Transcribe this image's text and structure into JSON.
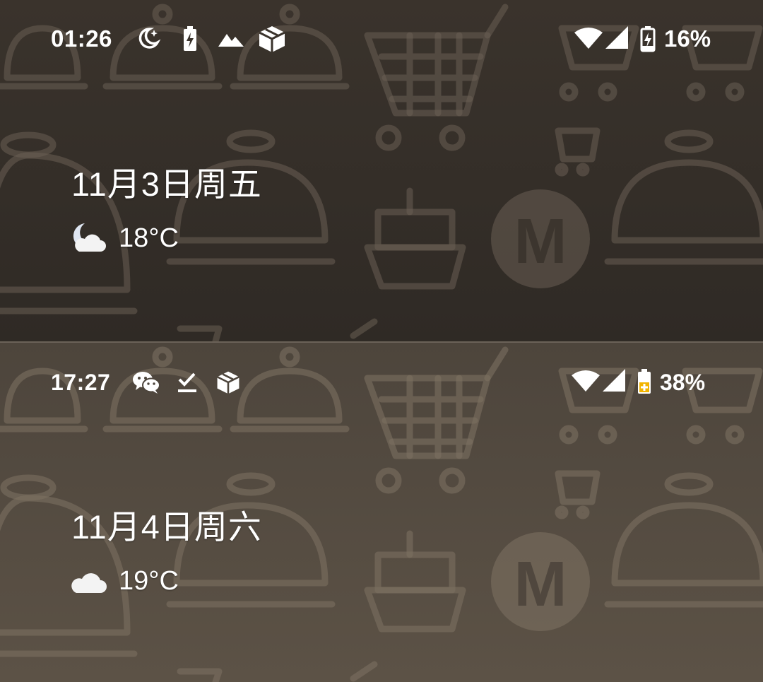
{
  "screens": [
    {
      "status_bar": {
        "time": "01:26",
        "notification_icons": [
          "do-not-disturb-moon-icon",
          "battery-saver-icon",
          "mountain-app-icon",
          "package-box-icon"
        ],
        "battery_percent": "16%",
        "battery_state": "charging"
      },
      "date": "11月3日周五",
      "weather": {
        "icon": "moon-cloud-icon",
        "temperature": "18°C"
      }
    },
    {
      "status_bar": {
        "time": "17:27",
        "notification_icons": [
          "wechat-icon",
          "download-done-icon",
          "package-box-icon"
        ],
        "battery_percent": "38%",
        "battery_state": "charging",
        "battery_accent": "#f2b400"
      },
      "date": "11月4日周六",
      "weather": {
        "icon": "cloud-icon",
        "temperature": "19°C"
      }
    }
  ]
}
